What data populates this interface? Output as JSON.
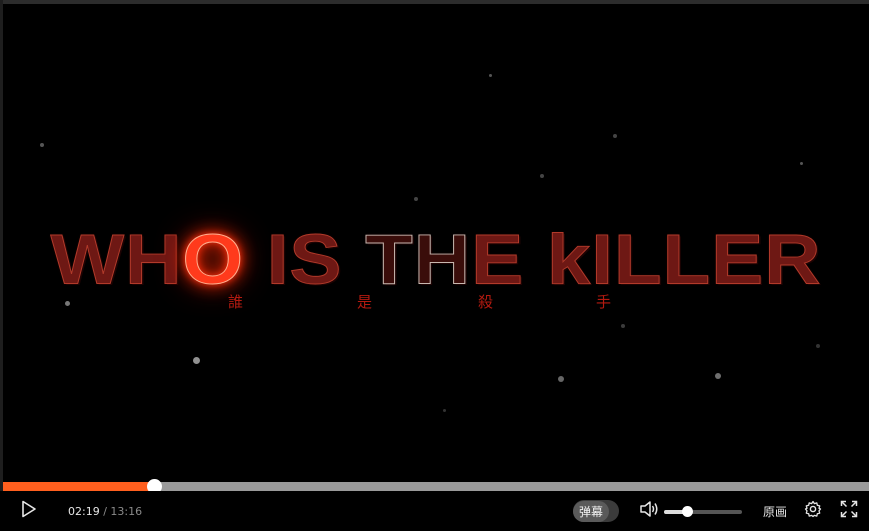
{
  "video": {
    "title_text": "WHO IS THE kILLER",
    "subtitle_chars": [
      "誰",
      "是",
      "殺",
      "手"
    ]
  },
  "player": {
    "current_time": "02:19",
    "separator": " / ",
    "duration": "13:16",
    "progress_fraction": 0.1747,
    "danmaku_label": "弹幕",
    "volume_fraction": 0.3,
    "quality_label": "原画",
    "accent_color": "#ff5f1e"
  },
  "icons": [
    "play-icon",
    "volume-icon",
    "settings-gear-icon",
    "fullscreen-icon"
  ]
}
